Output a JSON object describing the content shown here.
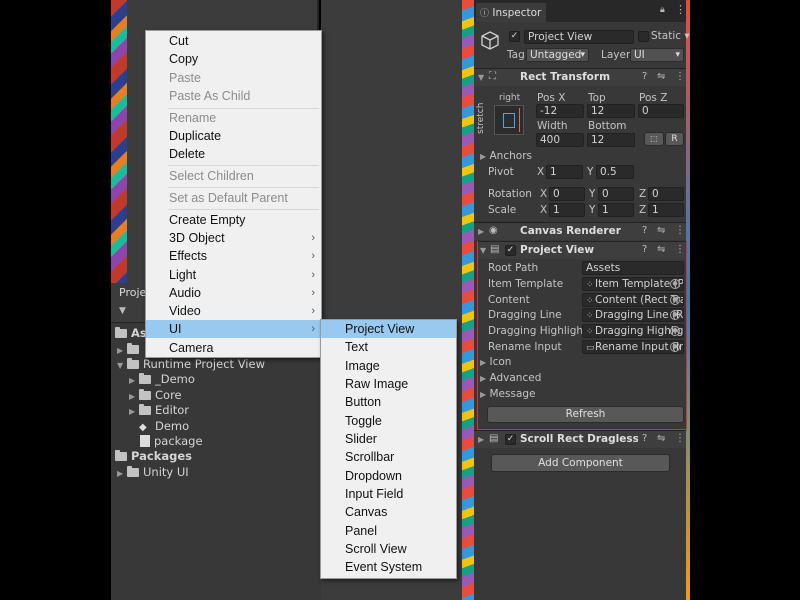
{
  "context_menu": {
    "items": [
      {
        "label": "Cut",
        "disabled": false
      },
      {
        "label": "Copy",
        "disabled": false
      },
      {
        "label": "Paste",
        "disabled": true
      },
      {
        "label": "Paste As Child",
        "disabled": true
      },
      {
        "label": "Rename",
        "disabled": true
      },
      {
        "label": "Duplicate",
        "disabled": false
      },
      {
        "label": "Delete",
        "disabled": false
      },
      {
        "label": "Select Children",
        "disabled": true
      },
      {
        "label": "Set as Default Parent",
        "disabled": true
      },
      {
        "label": "Create Empty",
        "disabled": false
      },
      {
        "label": "3D Object",
        "disabled": false,
        "submenu": true
      },
      {
        "label": "Effects",
        "disabled": false,
        "submenu": true
      },
      {
        "label": "Light",
        "disabled": false,
        "submenu": true
      },
      {
        "label": "Audio",
        "disabled": false,
        "submenu": true
      },
      {
        "label": "Video",
        "disabled": false,
        "submenu": true
      },
      {
        "label": "UI",
        "disabled": false,
        "submenu": true,
        "selected": true
      },
      {
        "label": "Camera",
        "disabled": false
      }
    ]
  },
  "ui_submenu": {
    "items": [
      "Project View",
      "Text",
      "Image",
      "Raw Image",
      "Button",
      "Toggle",
      "Slider",
      "Scrollbar",
      "Dropdown",
      "Input Field",
      "Canvas",
      "Panel",
      "Scroll View",
      "Event System"
    ],
    "selected": "Project View"
  },
  "project_panel": {
    "tab_label": "Proje",
    "tree": {
      "assets_label": "As",
      "runtime_label": "Runtime Project View",
      "demo_folder": "_Demo",
      "core": "Core",
      "editor": "Editor",
      "demo_scene": "Demo",
      "package": "package",
      "packages_label": "Packages",
      "unity_ui": "Unity UI"
    }
  },
  "inspector": {
    "tab_label": "Inspector",
    "object_name": "Project View",
    "static_label": "Static",
    "tag_label": "Tag",
    "tag_value": "Untagged",
    "layer_label": "Layer",
    "layer_value": "UI",
    "rect_transform": {
      "title": "Rect Transform",
      "anchor_h": "right",
      "anchor_v": "stretch",
      "pos_x_label": "Pos X",
      "pos_x": "-12",
      "top_label": "Top",
      "top": "12",
      "pos_z_label": "Pos Z",
      "pos_z": "0",
      "width_label": "Width",
      "width": "400",
      "bottom_label": "Bottom",
      "bottom": "12",
      "r_button": "R",
      "anchors_label": "Anchors",
      "pivot_label": "Pivot",
      "pivot_x": "1",
      "pivot_y": "0.5",
      "rotation_label": "Rotation",
      "rot_x": "0",
      "rot_y": "0",
      "rot_z": "0",
      "scale_label": "Scale",
      "scale_x": "1",
      "scale_y": "1",
      "scale_z": "1",
      "x": "X",
      "y": "Y",
      "z": "Z"
    },
    "canvas_renderer": {
      "title": "Canvas Renderer"
    },
    "project_view": {
      "title": "Project View",
      "root_path_label": "Root Path",
      "root_path": "Assets",
      "item_template_label": "Item Template",
      "item_template": "Item Template (P",
      "content_label": "Content",
      "content": "Content (Rect Tra",
      "dragging_line_label": "Dragging Line",
      "dragging_line": "Dragging Line (Re",
      "dragging_highlight_label": "Dragging Highlight",
      "dragging_highlight": "Dragging Highligh",
      "rename_input_label": "Rename Input",
      "rename_input": "Rename Input (Inp",
      "icon_label": "Icon",
      "advanced_label": "Advanced",
      "message_label": "Message",
      "refresh_button": "Refresh"
    },
    "scroll_rect": {
      "title": "Scroll Rect Dragless (Scri"
    },
    "add_component": "Add Component"
  },
  "colors": {
    "selection": "#99c9ef",
    "outline_red": "#d6303a",
    "panel_bg": "#383838"
  }
}
